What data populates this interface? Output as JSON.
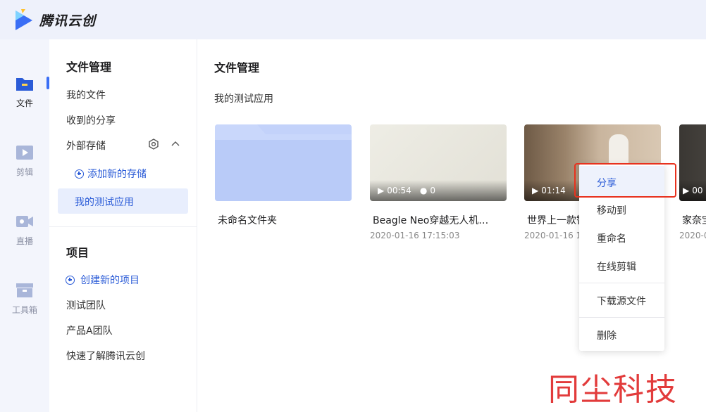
{
  "brand": {
    "name": "腾讯云创"
  },
  "rail": [
    {
      "icon": "folder-icon",
      "label": "文件",
      "active": true
    },
    {
      "icon": "edit-video-icon",
      "label": "剪辑"
    },
    {
      "icon": "live-camera-icon",
      "label": "直播"
    },
    {
      "icon": "toolbox-icon",
      "label": "工具箱"
    }
  ],
  "sidebar": {
    "file_section_title": "文件管理",
    "items": [
      "我的文件",
      "收到的分享",
      "外部存储"
    ],
    "add_storage": "添加新的存储",
    "active_app": "我的测试应用",
    "project_section_title": "项目",
    "create_project": "创建新的项目",
    "projects": [
      "测试团队",
      "产品A团队",
      "快速了解腾讯云创"
    ]
  },
  "main": {
    "title": "文件管理",
    "subtitle": "我的测试应用",
    "cards": [
      {
        "type": "folder",
        "name": "未命名文件夹",
        "date": ""
      },
      {
        "type": "video",
        "name": "Beagle Neo穿越无人机…",
        "date": "2020-01-16 17:15:03",
        "duration": "00:54",
        "comments": "0"
      },
      {
        "type": "video",
        "name": "世界上一款智",
        "date": "2020-01-16 17",
        "duration": "01:14",
        "comments": ""
      },
      {
        "type": "video",
        "name": "家奈宝",
        "date": "2020-0",
        "duration": "00",
        "comments": ""
      }
    ]
  },
  "context_menu": {
    "items": [
      "分享",
      "移动到",
      "重命名",
      "在线剪辑",
      "下载源文件",
      "删除"
    ]
  },
  "watermark": "同尘科技",
  "colors": {
    "accent": "#2a5bd7",
    "highlight_border": "#e8321e"
  }
}
